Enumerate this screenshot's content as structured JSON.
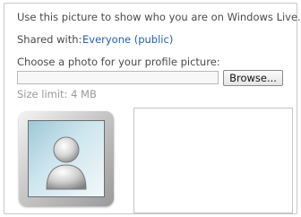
{
  "intro": {
    "text": "Use this picture to show who you are on Windows Live."
  },
  "shared": {
    "label": "Shared with:",
    "value": "Everyone (public)"
  },
  "upload": {
    "label": "Choose a photo for your profile picture:",
    "file_value": "",
    "browse_label": "Browse...",
    "size_limit": "Size limit: 4 MB"
  },
  "picture": {
    "icon": "default-user-avatar-icon"
  },
  "colors": {
    "link": "#1f5fbf",
    "muted": "#9a9a9a",
    "text": "#4a4a4a"
  }
}
